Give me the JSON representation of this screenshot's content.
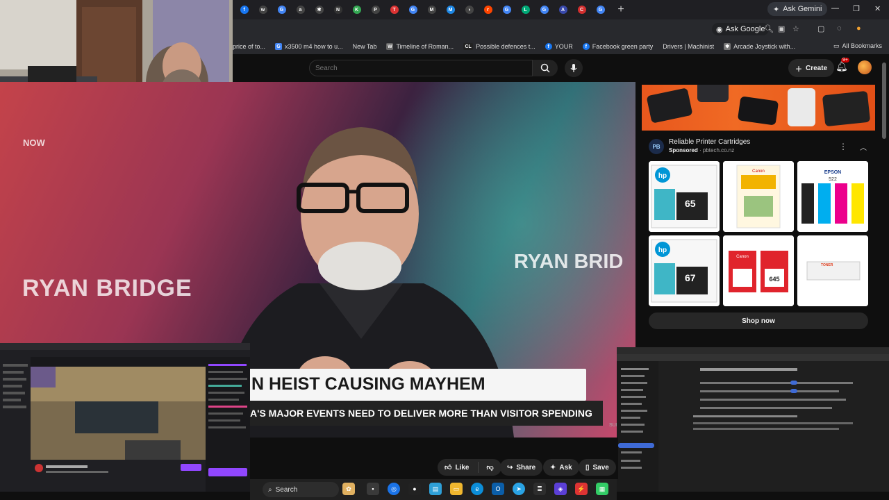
{
  "browser": {
    "tabs": [
      {
        "label": "f",
        "color": "#1877f2"
      },
      {
        "label": "w",
        "color": "#444"
      },
      {
        "label": "G",
        "color": "#4285f4"
      },
      {
        "label": "a",
        "color": "#444"
      },
      {
        "label": "✱",
        "color": "#444"
      },
      {
        "label": "N",
        "color": "#333"
      },
      {
        "label": "K",
        "color": "#34a853"
      },
      {
        "label": "P",
        "color": "#444"
      },
      {
        "label": "T",
        "color": "#d33"
      },
      {
        "label": "G",
        "color": "#4285f4"
      },
      {
        "label": "M",
        "color": "#444"
      },
      {
        "label": "M",
        "color": "#1e88e5"
      },
      {
        "label": "◑",
        "color": "#444"
      },
      {
        "label": "r",
        "color": "#ff4500"
      },
      {
        "label": "G",
        "color": "#4285f4"
      },
      {
        "label": "L",
        "color": "#0a7"
      },
      {
        "label": "G",
        "color": "#4285f4"
      },
      {
        "label": "A",
        "color": "#3949ab"
      },
      {
        "label": "C",
        "color": "#d32f2f"
      },
      {
        "label": "G",
        "color": "#4285f4"
      }
    ],
    "new_tab": "+",
    "ask_gemini": "Ask Gemini",
    "window_controls": [
      "—",
      "❐",
      "✕"
    ],
    "ask_google": "Ask Google",
    "bookmarks": [
      {
        "label": "price of to...",
        "icon": "",
        "color": "#888"
      },
      {
        "label": "x3500 m4 how to u...",
        "icon": "G",
        "color": "#4285f4"
      },
      {
        "label": "New Tab",
        "icon": "",
        "color": "#888"
      },
      {
        "label": "Timeline of Roman...",
        "icon": "W",
        "color": "#666"
      },
      {
        "label": "Possible defences t...",
        "icon": "CL",
        "color": "#222"
      },
      {
        "label": "YOUR",
        "icon": "f",
        "color": "#1877f2"
      },
      {
        "label": "Facebook green party",
        "icon": "f",
        "color": "#1877f2"
      },
      {
        "label": "Drivers | Machinist",
        "icon": "",
        "color": "#888"
      },
      {
        "label": "Arcade Joystick with...",
        "icon": "✱",
        "color": "#777"
      }
    ],
    "all_bookmarks": "All Bookmarks"
  },
  "youtube": {
    "search_placeholder": "Search",
    "create_label": "Create",
    "notification_badge": "9+",
    "video": {
      "now_tag": "NOW",
      "bg_text_left": "RYAN BRIDGE",
      "bg_text_right": "RYAN BRID",
      "lower_third_title": "N HEIST CAUSING MAYHEM",
      "lower_third_subtitle": "A'S MAJOR EVENTS NEED TO DELIVER MORE THAN VISITOR SPENDING",
      "corner_hint": "SUB"
    },
    "actions": {
      "like": "Like",
      "share": "Share",
      "ask": "Ask",
      "save": "Save"
    },
    "ad": {
      "logo": "PB",
      "title": "Reliable Printer Cartridges",
      "sponsored": "Sponsored",
      "domain": "pbtech.co.nz",
      "shop_now": "Shop now",
      "products": [
        {
          "brand": "hp",
          "number": "65",
          "kind": "ink"
        },
        {
          "brand": "Canon",
          "number": "",
          "kind": "photo-paper"
        },
        {
          "brand": "EPSON",
          "number": "522",
          "kind": "bottles"
        },
        {
          "brand": "hp",
          "number": "67",
          "kind": "ink"
        },
        {
          "brand": "Canon",
          "number": "645",
          "kind": "ink-pair"
        },
        {
          "brand": "TONER",
          "number": "",
          "kind": "toner"
        }
      ]
    }
  },
  "taskbar": {
    "search_label": "Search"
  }
}
